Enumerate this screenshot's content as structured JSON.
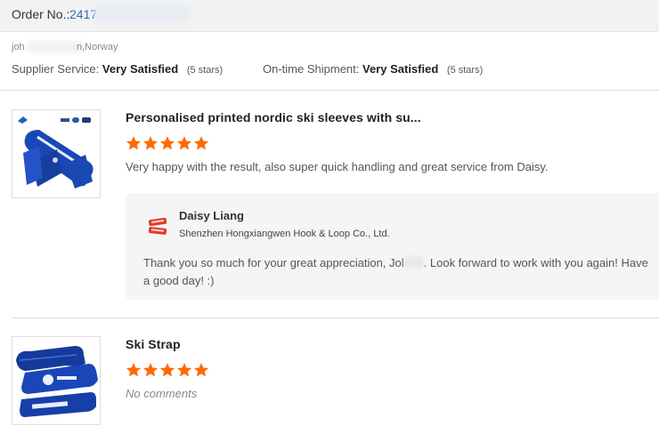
{
  "order": {
    "label": "Order No.:",
    "number_visible": "2417"
  },
  "buyer": {
    "name_prefix": "joh",
    "country_suffix": "n,Norway"
  },
  "ratings": {
    "supplier_label": "Supplier Service:",
    "supplier_value": "Very Satisfied",
    "supplier_stars": "(5 stars)",
    "shipment_label": "On-time Shipment:",
    "shipment_value": "Very Satisfied",
    "shipment_stars": "(5 stars)"
  },
  "colors": {
    "star": "#ff6a00",
    "link": "#2a6ebb"
  },
  "products": [
    {
      "title": "Personalised printed nordic ski sleeves with su...",
      "rating": 5,
      "review": "Very happy with the result, also super quick handling and great service from Daisy.",
      "icon": "ski-sleeve-product-image",
      "reply": {
        "logo_icon": "supplier-logo-icon",
        "name": "Daisy Liang",
        "company": "Shenzhen Hongxiangwen Hook & Loop Co., Ltd.",
        "text_before_name": "Thank you so much for your great appreciation, Jol",
        "text_after_name": ". Look forward to work with you again! Have a good day! :)"
      }
    },
    {
      "title": "Ski Strap",
      "rating": 5,
      "review": "No comments",
      "icon": "ski-strap-product-image"
    }
  ]
}
